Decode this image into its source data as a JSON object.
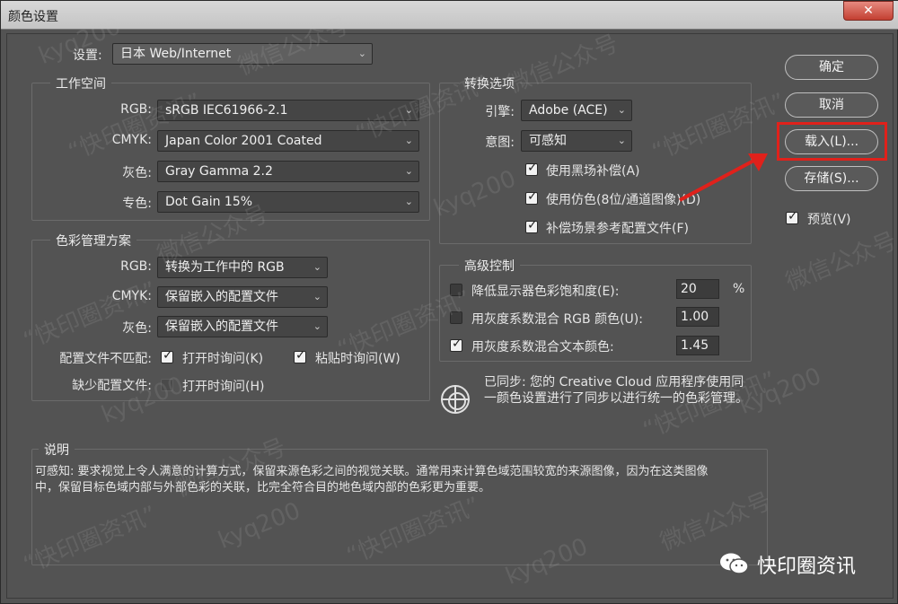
{
  "window": {
    "title": "颜色设置",
    "close": "✕"
  },
  "settings": {
    "label": "设置:",
    "value": "日本 Web/Internet"
  },
  "working_spaces": {
    "legend": "工作空间",
    "rgb": {
      "label": "RGB:",
      "value": "sRGB IEC61966-2.1"
    },
    "cmyk": {
      "label": "CMYK:",
      "value": "Japan Color 2001 Coated"
    },
    "gray": {
      "label": "灰色:",
      "value": "Gray Gamma 2.2"
    },
    "spot": {
      "label": "专色:",
      "value": "Dot Gain 15%"
    }
  },
  "policies": {
    "legend": "色彩管理方案",
    "rgb": {
      "label": "RGB:",
      "value": "转换为工作中的 RGB"
    },
    "cmyk": {
      "label": "CMYK:",
      "value": "保留嵌入的配置文件"
    },
    "gray": {
      "label": "灰色:",
      "value": "保留嵌入的配置文件"
    },
    "mismatch": {
      "label": "配置文件不匹配:",
      "ask_open": "打开时询问(K)",
      "ask_paste": "粘贴时询问(W)"
    },
    "missing": {
      "label": "缺少配置文件:",
      "ask_open": "打开时询问(H)"
    }
  },
  "conversion": {
    "legend": "转换选项",
    "engine": {
      "label": "引擎:",
      "value": "Adobe (ACE)"
    },
    "intent": {
      "label": "意图:",
      "value": "可感知"
    },
    "bpc": "使用黑场补偿(A)",
    "dither": "使用仿色(8位/通道图像)(D)",
    "compensate": "补偿场景参考配置文件(F)"
  },
  "advanced": {
    "legend": "高级控制",
    "desaturate": {
      "label": "降低显示器色彩饱和度(E):",
      "value": "20",
      "unit": "%"
    },
    "blend_rgb": {
      "label": "用灰度系数混合 RGB 颜色(U):",
      "value": "1.00"
    },
    "blend_text": {
      "label": "用灰度系数混合文本颜色:",
      "value": "1.45"
    }
  },
  "sync": {
    "text": "已同步: 您的 Creative Cloud 应用程序使用同一颜色设置进行了同步以进行统一的色彩管理。"
  },
  "description": {
    "legend": "说明",
    "text": "可感知: 要求视觉上令人满意的计算方式，保留来源色彩之间的视觉关联。通常用来计算色域范围较宽的来源图像，因为在这类图像中，保留目标色域内部与外部色彩的关联，比完全符合目的地色域内部的色彩更为重要。"
  },
  "buttons": {
    "ok": "确定",
    "cancel": "取消",
    "load": "载入(L)...",
    "save": "存储(S)...",
    "preview": "预览(V)"
  },
  "watermark": {
    "text1": "“快印圈资讯”",
    "text2": "kyq200",
    "text3": "微信公众号",
    "brand": "快印圈资讯"
  },
  "icons": {
    "chevron": "chevron-down-icon",
    "sync": "sync-icon",
    "check": "check-icon",
    "arrow": "red-arrow-icon",
    "wechat": "wechat-icon"
  },
  "colors": {
    "dialog": "#535353",
    "highlight": "#e0211b"
  }
}
